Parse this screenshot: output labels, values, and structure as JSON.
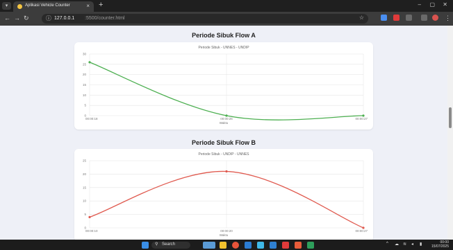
{
  "browser": {
    "tab_title": "Aplikasi Vehicle Counter",
    "url_host": "127.0.0.1",
    "url_path": ":5500/counter.html",
    "window_controls": {
      "minimize": "–",
      "maximize": "▢",
      "close": "✕"
    },
    "nav": {
      "back": "←",
      "forward": "→",
      "reload": "↻"
    }
  },
  "page": {
    "flow_a": {
      "heading": "Periode Sibuk Flow A",
      "chart_data": {
        "type": "line",
        "title": "Periode Sibuk - UNNES - UNDIP",
        "xlabel": "Waktu",
        "ylabel": "",
        "categories": [
          "00:00:18",
          "00:00:26",
          "00:00:27"
        ],
        "series": [
          {
            "values": [
              26,
              0,
              0
            ],
            "color": "#4caf50"
          }
        ],
        "ylim": [
          0,
          30
        ],
        "yticks": [
          0,
          5,
          10,
          15,
          20,
          25,
          30
        ],
        "grid": true
      }
    },
    "flow_b": {
      "heading": "Periode Sibuk Flow B",
      "chart_data": {
        "type": "line",
        "title": "Periode Sibuk - UNDIP - UNNES",
        "xlabel": "Waktu",
        "ylabel": "",
        "categories": [
          "00:00:10",
          "00:00:20",
          "00:00:27"
        ],
        "series": [
          {
            "values": [
              4,
              21,
              0
            ],
            "color": "#e05a4f"
          }
        ],
        "ylim": [
          0,
          25
        ],
        "yticks": [
          0,
          5,
          10,
          15,
          20,
          25
        ],
        "grid": true
      }
    }
  },
  "taskbar": {
    "search_label": "Search",
    "clock_time": "00:00",
    "clock_date": "15/07/2025"
  },
  "colors": {
    "flow_a_line": "#4caf50",
    "flow_b_line": "#e05a4f",
    "page_background": "#eef0f7"
  }
}
